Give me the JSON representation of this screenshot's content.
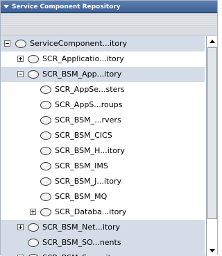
{
  "panel": {
    "title": "Service Component Repository"
  },
  "tree": {
    "items": [
      {
        "label": "ServiceComponent...itory",
        "expander": "minus"
      },
      {
        "label": "SCR_Applicatio...itory",
        "expander": "plus"
      },
      {
        "label": "SCR_BSM_App...itory",
        "expander": "minus"
      },
      {
        "label": "SCR_AppSe...sters",
        "expander": ""
      },
      {
        "label": "SCR_AppS...roups",
        "expander": ""
      },
      {
        "label": "SCR_BSM_...rvers",
        "expander": ""
      },
      {
        "label": "SCR_BSM_CICS",
        "expander": ""
      },
      {
        "label": "SCR_BSM_H...itory",
        "expander": ""
      },
      {
        "label": "SCR_BSM_IMS",
        "expander": ""
      },
      {
        "label": "SCR_BSM_J...itory",
        "expander": ""
      },
      {
        "label": "SCR_BSM_MQ",
        "expander": ""
      },
      {
        "label": "SCR_Databa...itory",
        "expander": "plus"
      },
      {
        "label": "SCR_BSM_Net...itory",
        "expander": "plus"
      },
      {
        "label": "SCR_BSM_SO...nents",
        "expander": ""
      },
      {
        "label": "SCR_BSM_Serv...itory",
        "expander": "plus"
      }
    ]
  },
  "colors": {
    "title_bar": "#3b5f93",
    "row_band": "#d4dce7",
    "toolbar": "#d6d9de"
  }
}
